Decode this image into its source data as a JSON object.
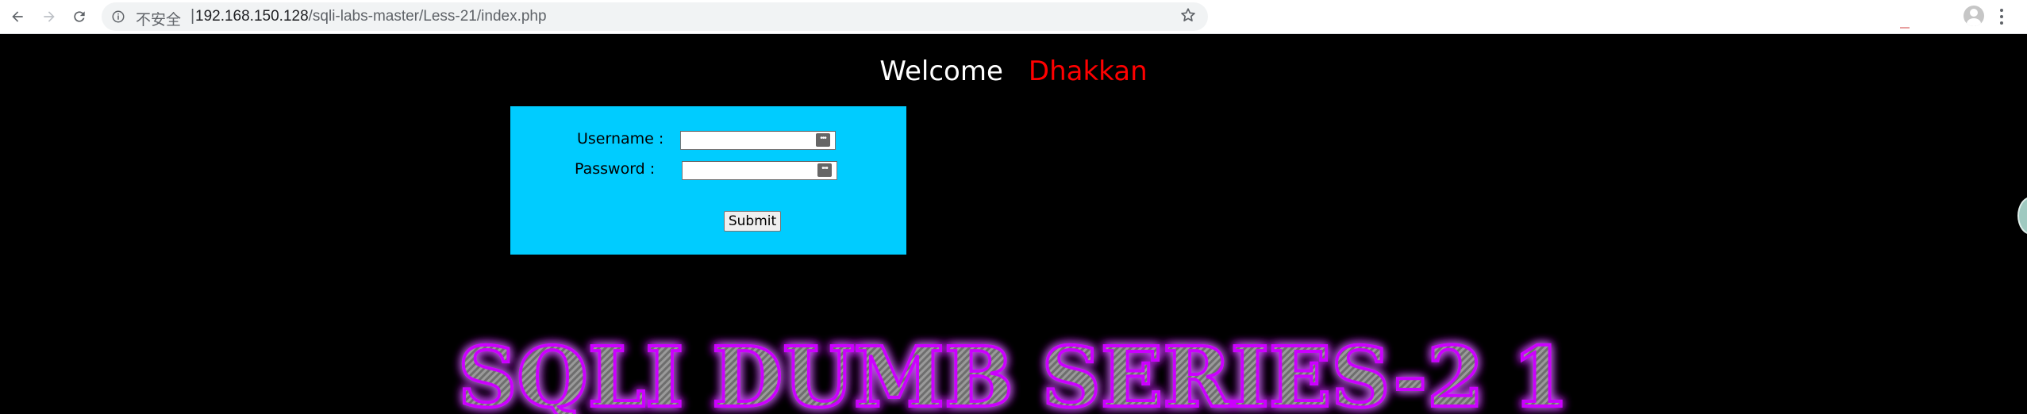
{
  "browser": {
    "security_label": "不安全",
    "separator": "|",
    "url_host": "192.168.150.128",
    "url_path": "/sqli-labs-master/Less-21/index.php"
  },
  "page": {
    "welcome": "Welcome",
    "name": "Dhakkan",
    "name_color": "#ff0000",
    "box_color": "#00ccff",
    "username_label": "Username :",
    "password_label": "Password :",
    "submit_label": "Submit",
    "banner_text": "SQLI DUMB SERIES-2 1",
    "banner_glow_color": "#cc00ff"
  },
  "icons": {
    "back": "arrow-left-icon",
    "forward": "arrow-right-icon",
    "reload": "reload-icon",
    "info": "info-icon",
    "bookmark": "star-icon",
    "profile": "avatar-icon",
    "menu": "kebab-menu-icon",
    "password_manager": "key-icon"
  }
}
